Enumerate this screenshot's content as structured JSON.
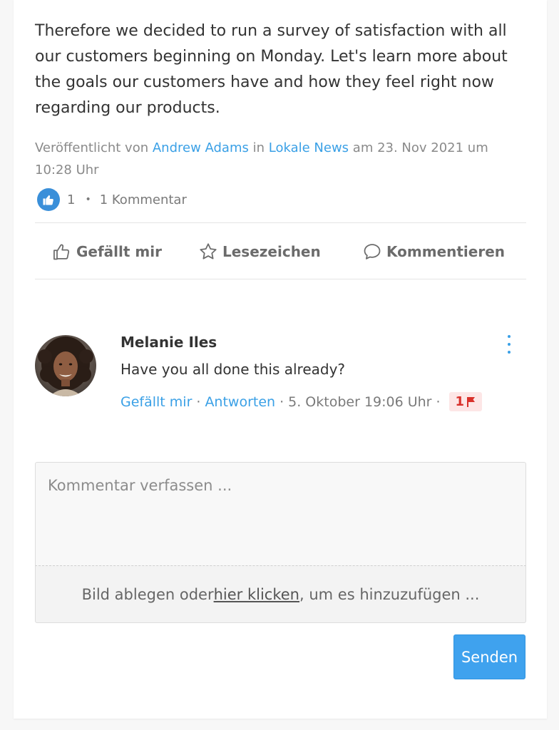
{
  "post": {
    "text": "Therefore we decided to run a survey of satisfaction with all our customers beginning on Monday. Let's learn more about the goals our customers have and how they feel right now regarding our products.",
    "meta_prefix": "Veröffentlicht von ",
    "author": "Andrew Adams",
    "meta_in": " in ",
    "space": "Lokale News",
    "meta_date": " am 23. Nov 2021 um 10:28 Uhr",
    "like_count": "1",
    "separator": "•",
    "comment_count": "1 Kommentar"
  },
  "actions": {
    "like": "Gefällt mir",
    "bookmark": "Lesezeichen",
    "comment": "Kommentieren"
  },
  "comment": {
    "author": "Melanie Iles",
    "text": "Have you all done this already?",
    "like": "Gefällt mir",
    "reply": "Antworten",
    "time": "5. Oktober 19:06 Uhr",
    "sep": "·",
    "flag_count": "1"
  },
  "composer": {
    "placeholder": "Kommentar verfassen ...",
    "drop_prefix": "Bild ablegen oder ",
    "drop_link": "hier klicken",
    "drop_suffix": ", um es hinzuzufügen ...",
    "send": "Senden"
  },
  "colors": {
    "accent": "#3aa0e6",
    "button": "#3fa2ee",
    "flag_bg": "#fde6e6",
    "flag_fg": "#d9312b"
  }
}
